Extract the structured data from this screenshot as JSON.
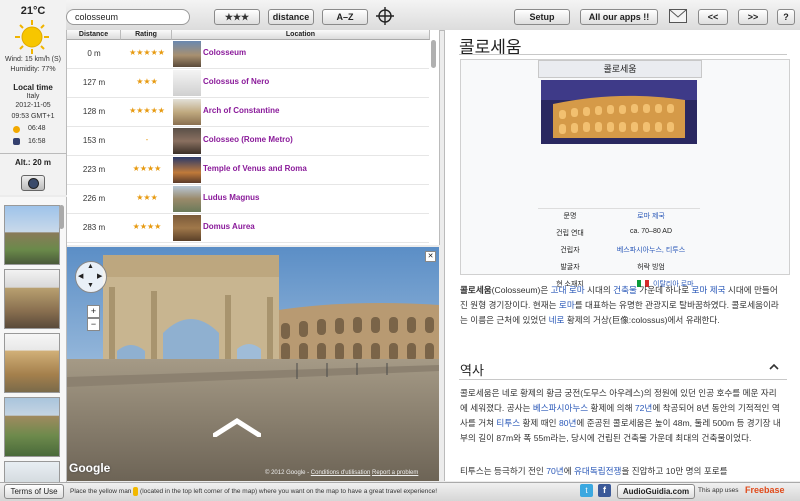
{
  "weather": {
    "temperature": "21°C",
    "wind": "Wind: 15 km/h (S)",
    "humidity": "Humidity: 77%",
    "local_time_label": "Local time",
    "country": "Italy",
    "date": "2012-11-05",
    "time": "09:53 GMT+1",
    "sunrise": "06:48",
    "sunset": "16:58",
    "altitude": "Alt.: 20 m"
  },
  "toolbar": {
    "search_value": "colosseum",
    "sort_rating": "★★★",
    "sort_distance": "distance",
    "sort_az": "A–Z",
    "setup": "Setup",
    "all_apps": "All our apps !!",
    "back": "<<",
    "forward": ">>",
    "help": "?"
  },
  "list": {
    "headers": [
      "Distance",
      "Rating",
      "Location"
    ],
    "rows": [
      {
        "distance": "0 m",
        "rating": "★★★★★",
        "name": "Colosseum"
      },
      {
        "distance": "127 m",
        "rating": "★★★",
        "name": "Colossus of Nero"
      },
      {
        "distance": "128 m",
        "rating": "★★★★★",
        "name": "Arch of Constantine"
      },
      {
        "distance": "153 m",
        "rating": "-",
        "name": "Colosseo (Rome Metro)"
      },
      {
        "distance": "223 m",
        "rating": "★★★★",
        "name": "Temple of Venus and Roma"
      },
      {
        "distance": "226 m",
        "rating": "★★★",
        "name": "Ludus Magnus"
      },
      {
        "distance": "283 m",
        "rating": "★★★★",
        "name": "Domus Aurea"
      }
    ]
  },
  "map": {
    "google_logo": "Google",
    "copyright": "© 2012 Google -",
    "terms": "Conditions d'utilisation",
    "report": "Report a problem"
  },
  "article": {
    "title": "콜로세움",
    "infobox_title": "콜로세움",
    "infobox_rows": [
      {
        "label": "문명",
        "value": "로마 제국",
        "link": true
      },
      {
        "label": "건립 연대",
        "value": "ca. 70–80 AD",
        "link": false
      },
      {
        "label": "건립자",
        "value": "베스파시아누스, 티투스",
        "link": true
      },
      {
        "label": "발굴자",
        "value": "허락 빙엄",
        "link": false
      },
      {
        "label": "현 소재지",
        "value": "이탈리아 로마",
        "link": true
      }
    ],
    "intro_bold": "콜로세움",
    "intro_p1": "(Colosseum)은 ",
    "intro_l1": "고대 로마",
    "intro_p2": " 시대의 ",
    "intro_l2": "건축물",
    "intro_p3": " 가운데 하나로 ",
    "intro_l3": "로마 제국",
    "intro_p4": " 시대에 만들어진 원형 경기장이다. 현재는 ",
    "intro_l4": "로마",
    "intro_p5": "를 대표하는 유명한 관광지로 탈바꿈하였다. 콜로세움이라는 이름은 근처에 있었던 ",
    "intro_l5": "네로",
    "intro_p6": " 황제의 거상(巨像:colossus)에서 유래한다.",
    "history_heading": "역사",
    "hist_p1": "콜로세움은 네로 황제의 황금 궁전(도무스 아우레스)의 정원에 있던 인공 호수를 메운 자리에 세워졌다. 공사는 ",
    "hist_l1": "베스파시아누스",
    "hist_p2": " 황제에 의해 ",
    "hist_l2": "72년",
    "hist_p3": "에 착공되어 8년 동안의 기적적인 역사를 거쳐 ",
    "hist_l3": "티투스",
    "hist_p4": " 황제 때인 ",
    "hist_l4": "80년",
    "hist_p5": "에 준공된 콜로세움은 높이 48m, 둘레 500m 등 경기장 내부의 길이 87m와 폭 55m라는, 당시에 건립된 건축물 가운데 최대의 건축물이었다.",
    "last_p1": "티투스는 등극하기 전인 ",
    "last_l1": "70년",
    "last_p2": "에 ",
    "last_l2": "유대독립전쟁",
    "last_p3": "을 진압하고 10만 명의 포로를"
  },
  "bottom": {
    "terms_button": "Terms of Use",
    "hint": "Place the yellow man",
    "hint2": "(located in the top left corner of the map) where you want on the map to have a great travel experience!",
    "audioguidia": "AudioGuidia.com",
    "uses": "This app uses",
    "freebase": "Freebase"
  },
  "colors": {
    "link_purple": "#8a1a9a",
    "link_blue": "#2a58b8",
    "star_orange": "#e79a10"
  }
}
